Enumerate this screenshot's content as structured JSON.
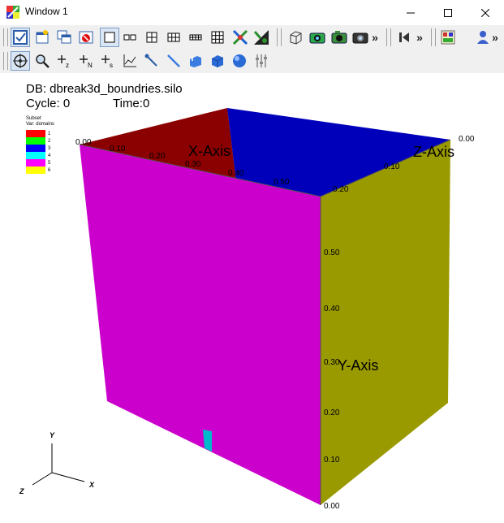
{
  "window": {
    "title": "Window 1"
  },
  "toolbar": {
    "overflow1": "»",
    "overflow2": "»",
    "overflow3": "»"
  },
  "hud": {
    "db": "DB: dbreak3d_boundries.silo",
    "cycle": "Cycle: 0",
    "time": "Time:0"
  },
  "legend": {
    "title1": "Subset",
    "title2": "Var: domains",
    "items": [
      {
        "label": "1",
        "color": "#ff0000"
      },
      {
        "label": "2",
        "color": "#00ff00"
      },
      {
        "label": "3",
        "color": "#0000ff"
      },
      {
        "label": "4",
        "color": "#00ffff"
      },
      {
        "label": "5",
        "color": "#ff00ff"
      },
      {
        "label": "6",
        "color": "#ffff00"
      }
    ]
  },
  "axes": {
    "x_title": "X-Axis",
    "y_title": "Y-Axis",
    "z_title": "Z-Axis",
    "x_ticks": [
      "0.00",
      "0.10",
      "0.20",
      "0.30",
      "0.40",
      "0.50"
    ],
    "y_ticks": [
      "0.00",
      "0.10",
      "0.20",
      "0.30",
      "0.40",
      "0.50"
    ],
    "z_ticks": [
      "0.00",
      "0.10",
      "0.20"
    ],
    "triad": {
      "x": "X",
      "y": "Y",
      "z": "Z"
    }
  },
  "colors": {
    "front_face": "#cc00cc",
    "right_face": "#999900",
    "top_red": "#8b0000",
    "top_blue": "#0000bb",
    "cyan_patch": "#00bbcc",
    "titlebar_bg": "#ffffff",
    "toolbar_bg": "#f0f0f0"
  }
}
